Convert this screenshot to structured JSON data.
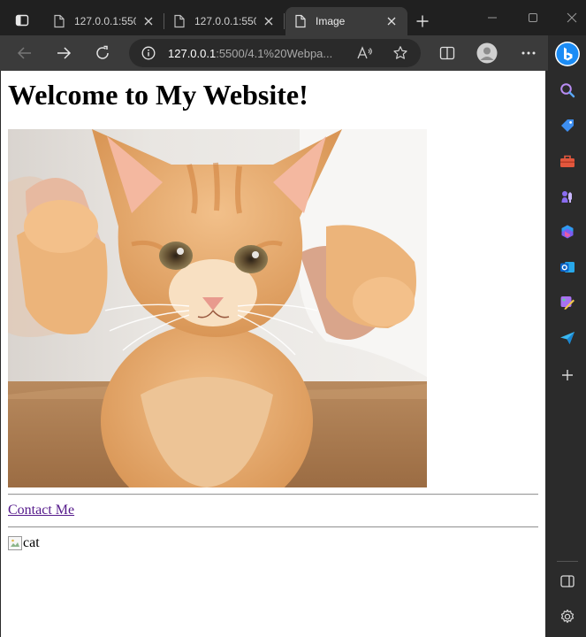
{
  "browser": {
    "tabs": [
      {
        "title": "127.0.0.1:5500/",
        "active": false
      },
      {
        "title": "127.0.0.1:5500/",
        "active": false
      },
      {
        "title": "Image",
        "active": true
      }
    ],
    "address": {
      "host": "127.0.0.1",
      "path": ":5500/4.1%20Webpa..."
    }
  },
  "page": {
    "heading": "Welcome to My Website!",
    "contact_link": "Contact Me",
    "broken_image_alt": "cat"
  },
  "colors": {
    "chrome_bg": "#202020",
    "toolbar_bg": "#3b3b3b",
    "visited_link": "#551a8b",
    "bing_blue": "#1b8cf5"
  }
}
